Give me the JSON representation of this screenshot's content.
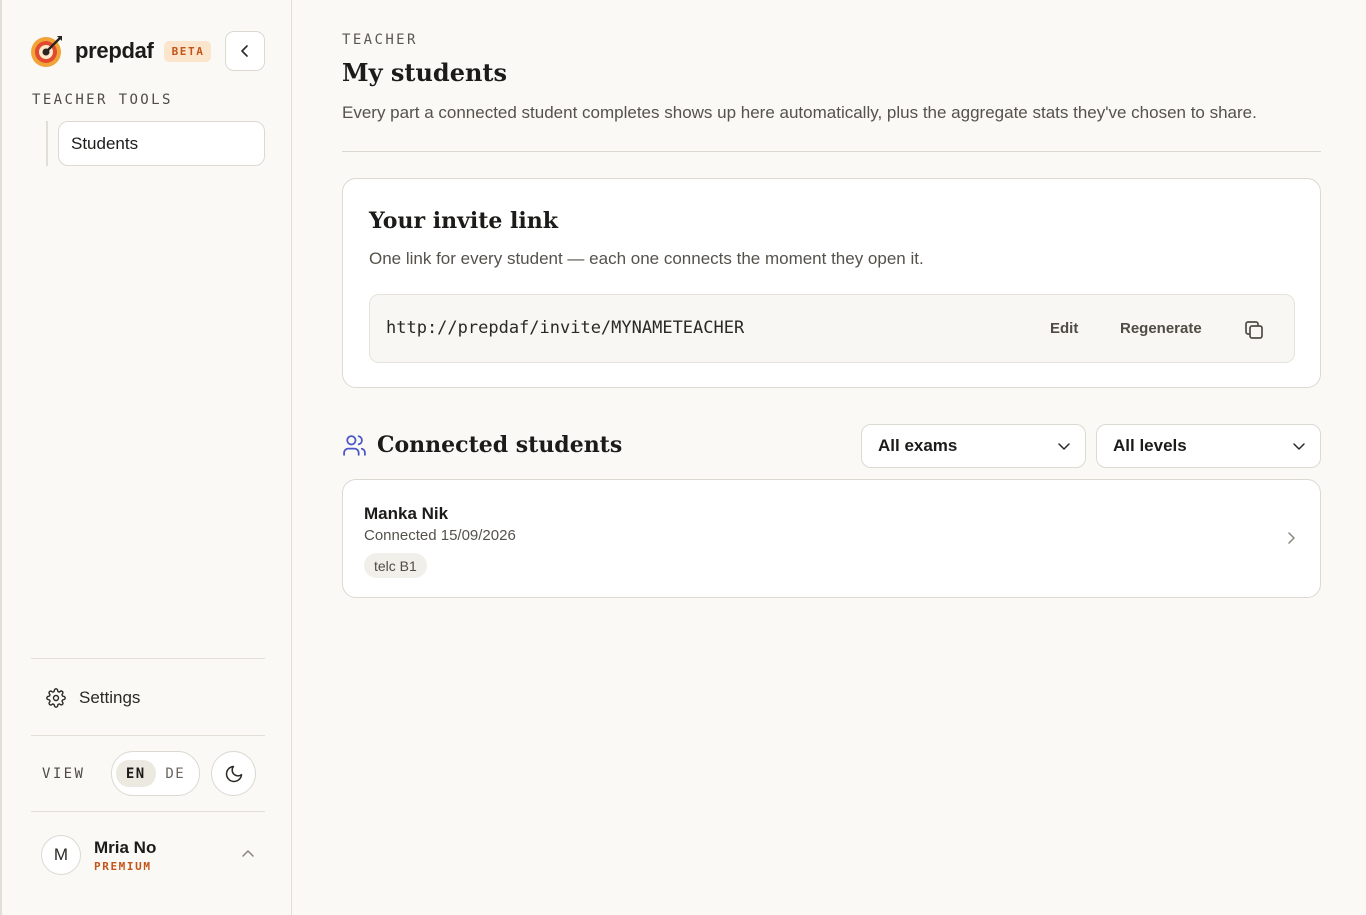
{
  "brand": {
    "name": "prepdaf",
    "badge": "BETA"
  },
  "sidebar": {
    "section_label": "TEACHER TOOLS",
    "items": [
      {
        "label": "Students",
        "icon": "none"
      }
    ],
    "settings_label": "Settings",
    "view_label": "VIEW",
    "languages": [
      {
        "code": "EN",
        "active": true
      },
      {
        "code": "DE",
        "active": false
      }
    ],
    "theme_icon": "moon-icon",
    "user": {
      "initial": "M",
      "name": "Mria No",
      "plan": "PREMIUM"
    }
  },
  "header": {
    "eyebrow": "TEACHER",
    "title": "My students",
    "description": "Every part a connected student completes shows up here automatically, plus the aggregate stats they've chosen to share."
  },
  "invite": {
    "title": "Your invite link",
    "description": "One link for every student — each one connects the moment they open it.",
    "url": "http://prepdaf/invite/MYNAMETEACHER",
    "edit_label": "Edit",
    "regenerate_label": "Regenerate"
  },
  "connected": {
    "title": "Connected students",
    "filters": {
      "exam": "All exams",
      "level": "All levels"
    },
    "students": [
      {
        "name": "Manka Nik",
        "connected": "Connected 15/09/2026",
        "tag": "telc B1"
      }
    ]
  },
  "colors": {
    "accent": "#c2551a",
    "badge_bg": "#fbe5cc",
    "icon_blue": "#4a55c9",
    "background": "#faf9f6"
  }
}
